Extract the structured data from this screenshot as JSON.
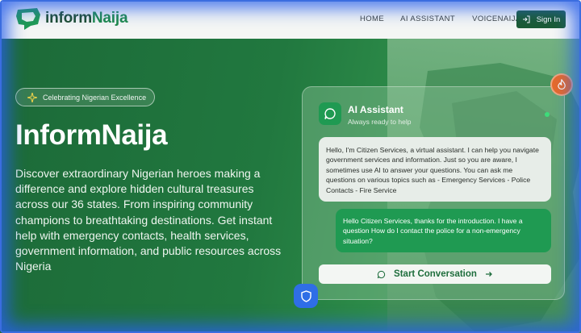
{
  "header": {
    "logo_text_part1": "inform",
    "logo_text_part2": "Naija",
    "nav": [
      {
        "label": "HOME"
      },
      {
        "label": "AI ASSISTANT"
      },
      {
        "label": "VOICENAIJA"
      }
    ],
    "signin_label": "Sign In"
  },
  "hero": {
    "badge": "Celebrating Nigerian Excellence",
    "title": "InformNaija",
    "description": "Discover extraordinary Nigerian heroes making a difference and explore hidden cultural treasures across our 36 states. From inspiring community champions to breathtaking destinations. Get instant help with emergency contacts, health services, government information, and public resources across Nigeria"
  },
  "assistant": {
    "title": "AI Assistant",
    "subtitle": "Always ready to help",
    "bot_message": "Hello, I'm Citizen Services, a virtual assistant. I can help you navigate government services and information. Just so you are aware, I sometimes use AI to answer your questions. You can ask me questions on various topics such as - Emergency Services - Police Contacts - Fire Service",
    "user_message": "Hello Citizen Services, thanks for the introduction. I have a question How do I contact the police for a non-emergency situation?",
    "start_button": "Start Conversation"
  },
  "icons": {
    "logo": "nigeria-chat-logo-icon",
    "signin": "login-arrow-icon",
    "badge": "sparkle-icon",
    "assistant": "chat-bubble-icon",
    "start": "chat-bubble-icon",
    "arrow": "arrow-right-icon",
    "fire": "flame-icon",
    "shield": "shield-icon"
  },
  "colors": {
    "brand_green": "#1b5b34",
    "accent_green": "#1f9a52",
    "fire_orange": "#e56a2c",
    "shield_blue": "#2f6ee6"
  }
}
